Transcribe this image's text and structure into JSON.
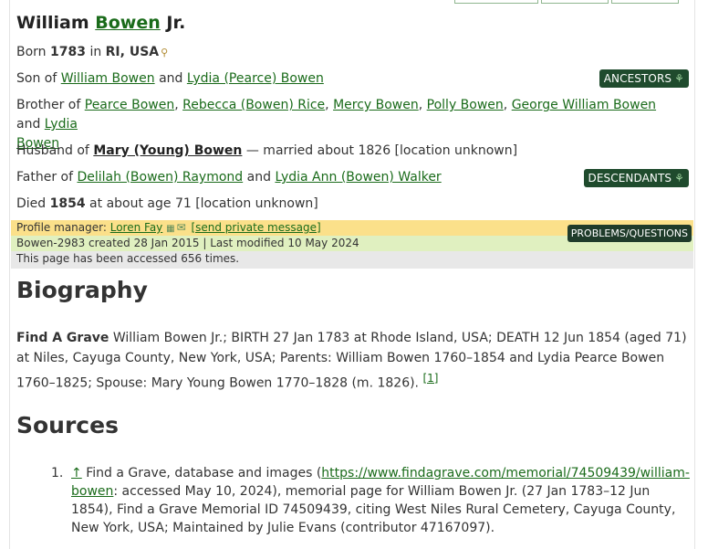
{
  "person": {
    "given": "William",
    "surname": "Bowen",
    "suffix": "Jr."
  },
  "born": {
    "prefix": "Born",
    "year": "1783",
    "mid": "in",
    "place": "RI, USA"
  },
  "son_of": {
    "prefix": "Son of",
    "father": "William Bowen",
    "and": "and",
    "mother": "Lydia (Pearce) Bowen"
  },
  "brother_of": {
    "prefix": "Brother of",
    "siblings": [
      "Pearce Bowen",
      "Rebecca (Bowen) Rice",
      "Mercy Bowen",
      "Polly Bowen",
      "George William Bowen"
    ],
    "and": "and",
    "last_part1": "Lydia",
    "last_part2": "Bowen"
  },
  "husband_of": {
    "prefix": "Husband of",
    "spouse": "Mary (Young) Bowen",
    "suffix": "— married about 1826 [location unknown]"
  },
  "father_of": {
    "prefix": "Father of",
    "child1": "Delilah (Bowen) Raymond",
    "and": "and",
    "child2": "Lydia Ann (Bowen) Walker"
  },
  "died": {
    "prefix": "Died",
    "year": "1854",
    "suffix": "at about age 71 [location unknown]"
  },
  "buttons": {
    "ancestors": "ANCESTORS",
    "descendants": "DESCENDANTS",
    "problems": "PROBLEMS/QUESTIONS"
  },
  "manager": {
    "label": "Profile manager:",
    "name": "Loren Fay",
    "message": "[send private message]"
  },
  "created": "Bowen-2983 created 28 Jan 2015 | Last modified 10 May 2024",
  "accessed": "This page has been accessed 656 times.",
  "biography": {
    "heading": "Biography",
    "source_name": "Find A Grave",
    "text": "William Bowen Jr.; BIRTH 27 Jan 1783 at Rhode Island, USA; DEATH 12 Jun 1854 (aged 71) at Niles, Cayuga County, New York, USA; Parents: William Bowen 1760–1854 and Lydia Pearce Bowen 1760–1825; Spouse: Mary Young Bowen 1770–1828 (m. 1826).",
    "footnote": "[1]"
  },
  "sources": {
    "heading": "Sources",
    "items": [
      {
        "number": "1.",
        "arrow": "↑",
        "lead": "Find a Grave, database and images (",
        "url": "https://www.findagrave.com/memorial/74509439/william-bowen",
        "rest": ": accessed May 10, 2024), memorial page for William Bowen Jr. (27 Jan 1783–12 Jun 1854), Find a Grave Memorial ID 74509439, citing West Niles Rural Cemetery, Cayuga County, New York, USA; Maintained by Julie Evans (contributor 47167097)."
      }
    ]
  }
}
